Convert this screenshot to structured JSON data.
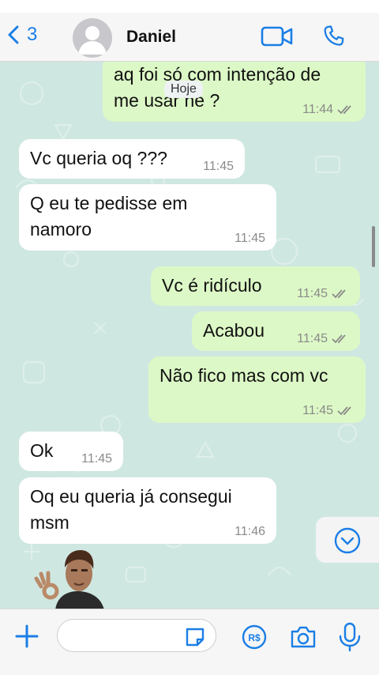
{
  "header": {
    "back_count": "3",
    "contact_name": "Daniel",
    "icons": [
      "back-chevron-icon",
      "avatar-placeholder-icon",
      "video-call-icon",
      "phone-call-icon"
    ]
  },
  "chat": {
    "date_chip": "Hoje",
    "messages": [
      {
        "dir": "out",
        "text": "aq foi só com intenção de\nme usar né ?",
        "time": "11:44",
        "read": true
      },
      {
        "dir": "in",
        "text": "Vc queria oq ???",
        "time": "11:45"
      },
      {
        "dir": "in",
        "text": "Q eu te pedisse em\nnamoro",
        "time": "11:45"
      },
      {
        "dir": "out",
        "text": "Vc é ridículo",
        "time": "11:45",
        "read": true
      },
      {
        "dir": "out",
        "text": "Acabou",
        "time": "11:45",
        "read": true
      },
      {
        "dir": "out",
        "text": "Não fico mas com vc",
        "time": "11:45",
        "read": true
      },
      {
        "dir": "in",
        "text": "Ok",
        "time": "11:45"
      },
      {
        "dir": "in",
        "text": "Oq eu queria já consegui\nmsm",
        "time": "11:46"
      }
    ],
    "sticker": "man-ok-gesture-sticker"
  },
  "composer": {
    "placeholder": "",
    "icons": [
      "plus-icon",
      "sticker-icon",
      "payment-icon",
      "camera-icon",
      "microphone-icon"
    ]
  },
  "colors": {
    "accent": "#1a7ee6",
    "outgoing_bubble": "#dcf8c6",
    "incoming_bubble": "#ffffff",
    "chat_bg": "#cfe7e1",
    "read_ticks": "#8a8a8a"
  }
}
